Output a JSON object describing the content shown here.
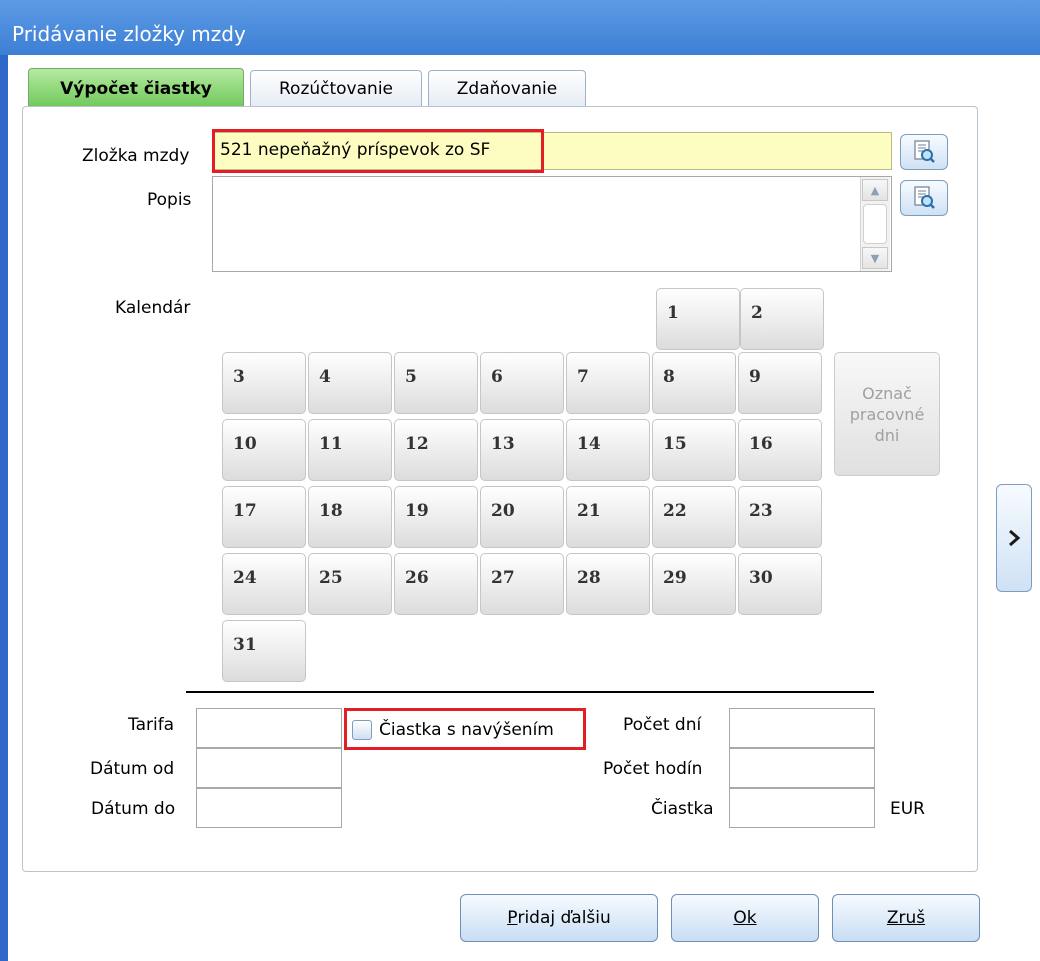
{
  "window": {
    "title": "Pridávanie zložky mzdy"
  },
  "tabs": [
    {
      "label": "Výpočet čiastky",
      "active": true
    },
    {
      "label": "Rozúčtovanie",
      "active": false
    },
    {
      "label": "Zdaňovanie",
      "active": false
    }
  ],
  "form": {
    "zlozka_label": "Zložka mzdy",
    "zlozka_value": "521  nepeňažný príspevok zo SF",
    "popis_label": "Popis",
    "popis_value": "",
    "kalendar_label": "Kalendár",
    "days": [
      "1",
      "2",
      "3",
      "4",
      "5",
      "6",
      "7",
      "8",
      "9",
      "10",
      "11",
      "12",
      "13",
      "14",
      "15",
      "16",
      "17",
      "18",
      "19",
      "20",
      "21",
      "22",
      "23",
      "24",
      "25",
      "26",
      "27",
      "28",
      "29",
      "30",
      "31"
    ],
    "mark_work_days": "Označ\npracovné\ndni",
    "tarifa_label": "Tarifa",
    "datum_od_label": "Dátum od",
    "datum_do_label": "Dátum do",
    "checkbox_label": "Čiastka s navýšením",
    "checkbox_checked": false,
    "pocet_dni_label": "Počet dní",
    "pocet_hodin_label": "Počet hodín",
    "ciastka_label": "Čiastka",
    "currency": "EUR"
  },
  "buttons": {
    "add_next_u": "P",
    "add_next_rest": "ridaj ďalšiu",
    "ok_u": "O",
    "ok_rest": "k",
    "cancel_u": "Z",
    "cancel_rest": "ruš"
  },
  "colors": {
    "titlebar": "#3d7fd4",
    "active_tab": "#6ec85a",
    "highlight_field": "#fdfdc2",
    "annotation_red": "#e31e24"
  }
}
